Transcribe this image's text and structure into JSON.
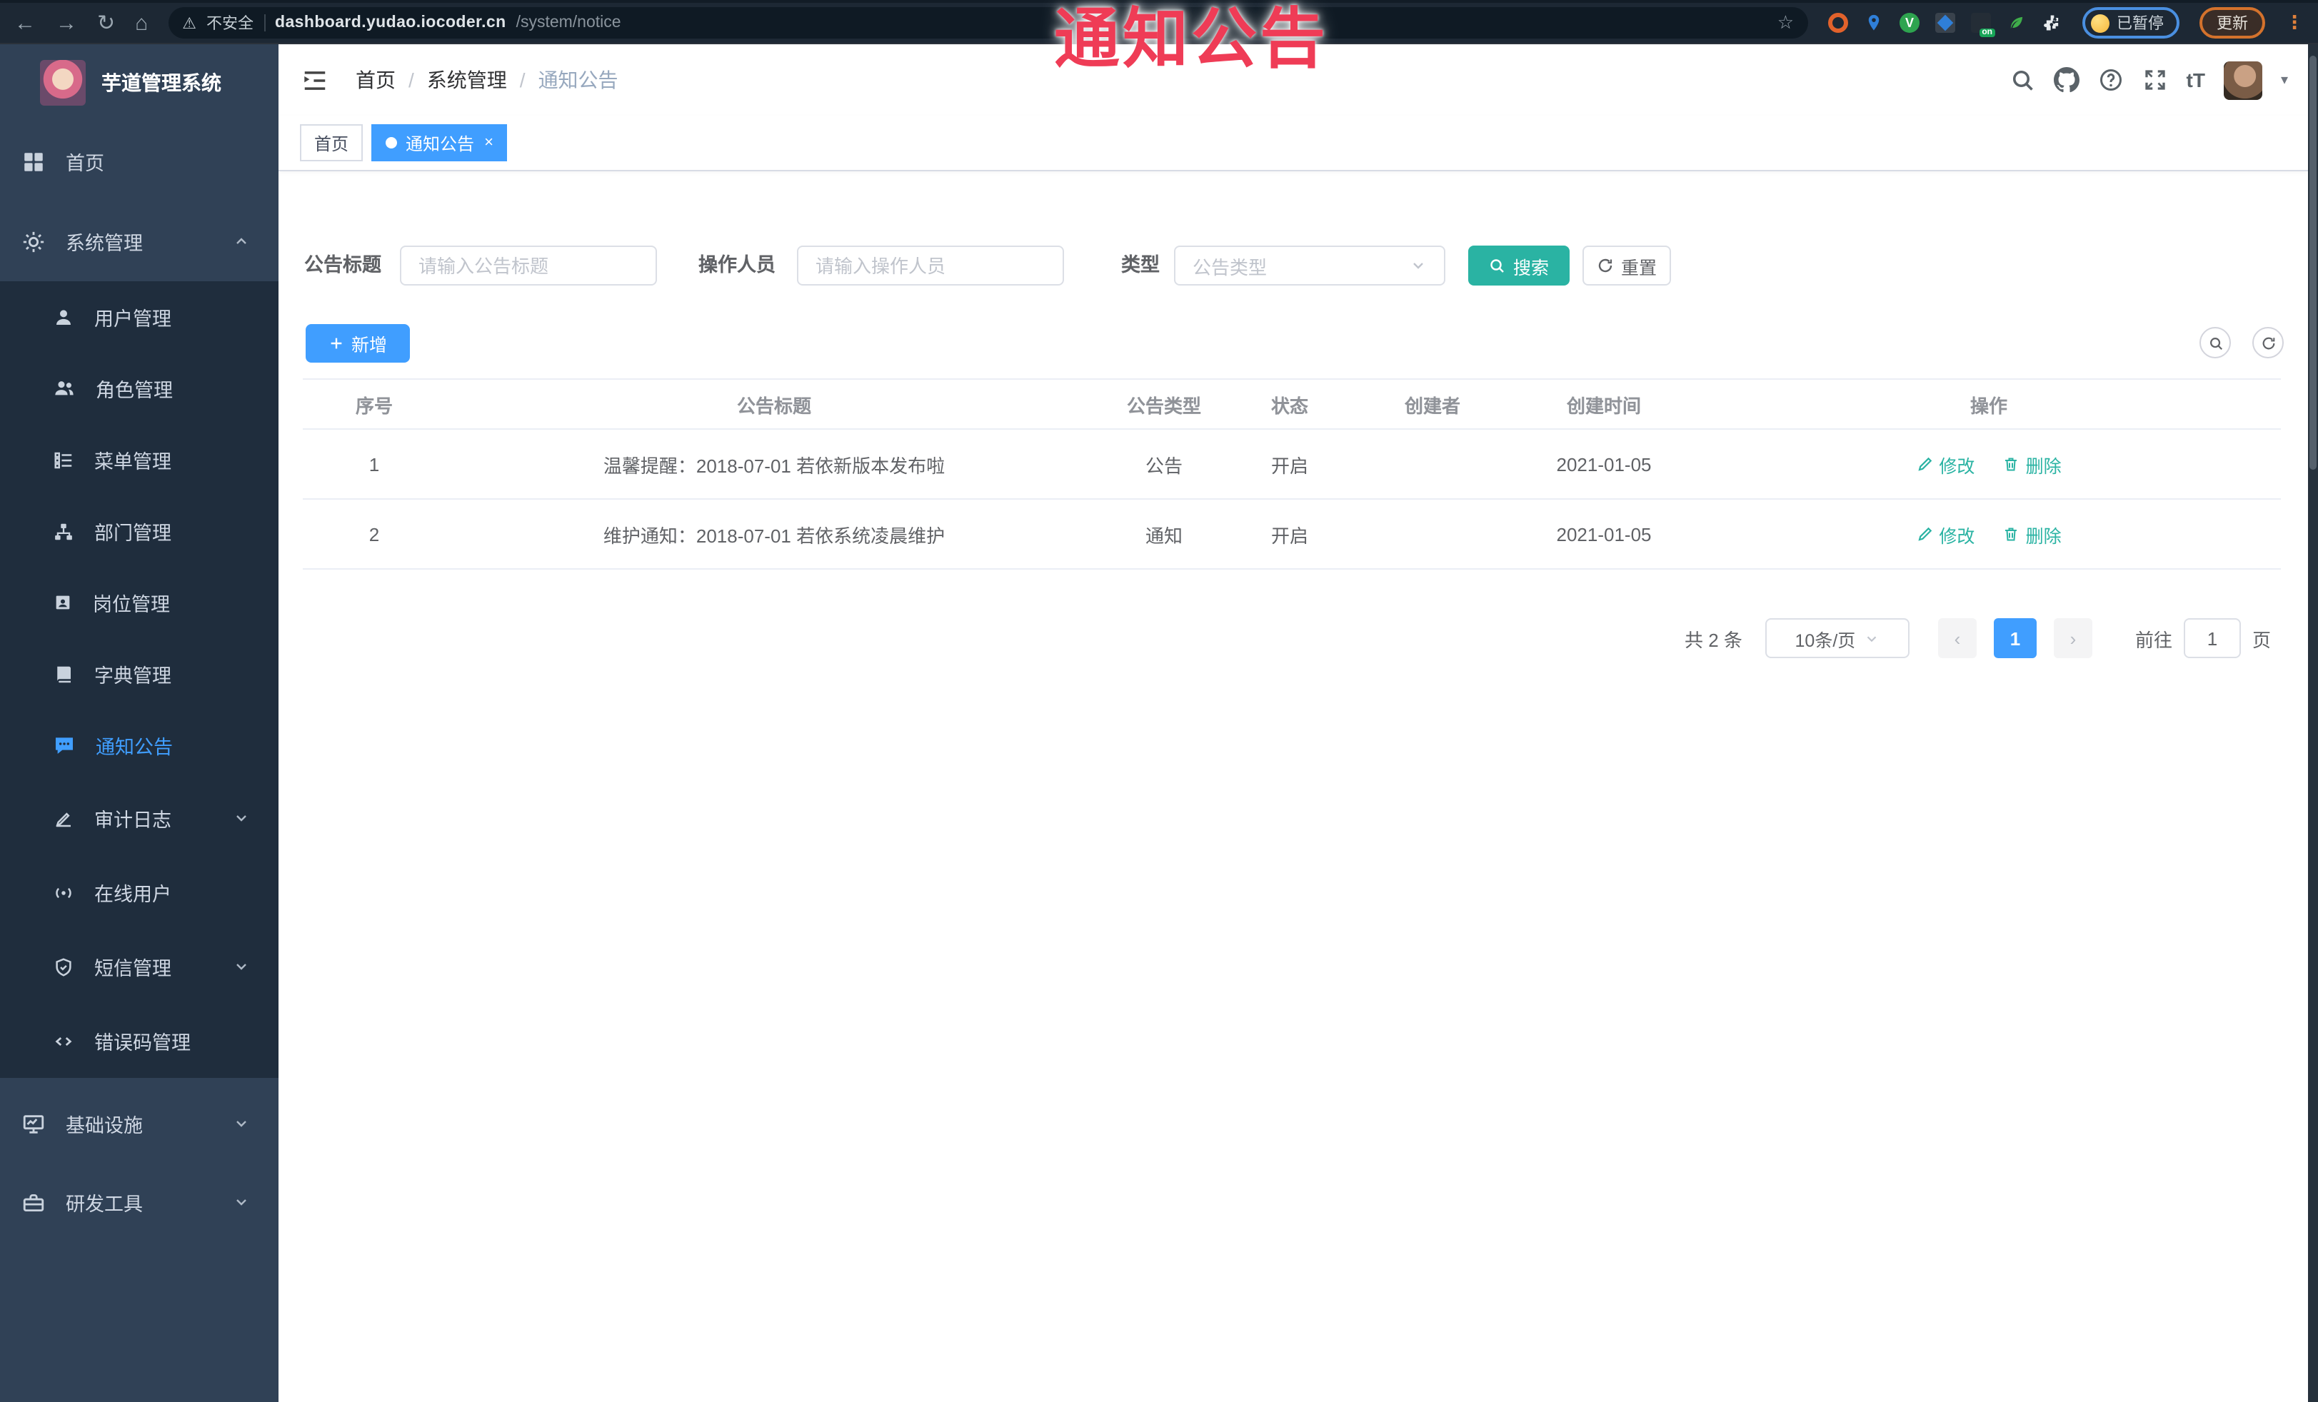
{
  "browser": {
    "security_label": "不安全",
    "url_host": "dashboard.yudao.iocoder.cn",
    "url_path": "/system/notice",
    "extension_badge": "on",
    "paused_label": "已暂停",
    "update_label": "更新"
  },
  "watermark": {
    "text": "通知公告",
    "color": "#ef3c56"
  },
  "sidebar": {
    "title": "芋道管理系统",
    "items": [
      {
        "label": "首页",
        "icon": "dashboard-icon"
      },
      {
        "label": "系统管理",
        "icon": "gear-icon",
        "arrow": "up",
        "expanded": true
      },
      {
        "label": "用户管理",
        "icon": "user-icon"
      },
      {
        "label": "角色管理",
        "icon": "users-icon"
      },
      {
        "label": "菜单管理",
        "icon": "menu-tree-icon"
      },
      {
        "label": "部门管理",
        "icon": "org-icon"
      },
      {
        "label": "岗位管理",
        "icon": "post-badge-icon"
      },
      {
        "label": "字典管理",
        "icon": "dictionary-icon"
      },
      {
        "label": "通知公告",
        "icon": "notice-bubble-icon",
        "active": true
      },
      {
        "label": "审计日志",
        "icon": "audit-pen-icon",
        "arrow": "down"
      },
      {
        "label": "在线用户",
        "icon": "online-user-icon"
      },
      {
        "label": "短信管理",
        "icon": "sms-shield-icon",
        "arrow": "down"
      },
      {
        "label": "错误码管理",
        "icon": "error-code-icon"
      },
      {
        "label": "基础设施",
        "icon": "infrastructure-icon",
        "arrow": "down"
      },
      {
        "label": "研发工具",
        "icon": "dev-tools-icon",
        "arrow": "down"
      }
    ]
  },
  "header": {
    "breadcrumb": [
      "首页",
      "系统管理",
      "通知公告"
    ],
    "font_size_icon_text": "tT"
  },
  "tabs": [
    {
      "label": "首页",
      "active": false
    },
    {
      "label": "通知公告",
      "active": true,
      "close": "×"
    }
  ],
  "filters": {
    "title_label": "公告标题",
    "title_placeholder": "请输入公告标题",
    "operator_label": "操作人员",
    "operator_placeholder": "请输入操作人员",
    "type_label": "类型",
    "type_placeholder": "公告类型",
    "search_label": "搜索",
    "reset_label": "重置"
  },
  "toolbar": {
    "add_label": "新增"
  },
  "table": {
    "columns": [
      "序号",
      "公告标题",
      "公告类型",
      "状态",
      "创建者",
      "创建时间",
      "操作"
    ],
    "rows": [
      {
        "no": "1",
        "title": "温馨提醒：2018-07-01 若依新版本发布啦",
        "type": "公告",
        "status": "开启",
        "creator": "",
        "created": "2021-01-05"
      },
      {
        "no": "2",
        "title": "维护通知：2018-07-01 若依系统凌晨维护",
        "type": "通知",
        "status": "开启",
        "creator": "",
        "created": "2021-01-05"
      }
    ],
    "edit_label": "修改",
    "delete_label": "删除"
  },
  "pagination": {
    "total_label": "共 2 条",
    "page_size_label": "10条/页",
    "prev_label": "‹",
    "current_page": "1",
    "next_label": "›",
    "goto_label": "前往",
    "goto_value": "1",
    "unit_label": "页"
  },
  "colors": {
    "primary": "#409eff",
    "search_teal": "#2ab3a3",
    "sidebar_bg": "#304156",
    "submenu_bg": "#1f2d3d",
    "chrome_bg": "#1d2834",
    "watermark_red": "#ef3c56"
  }
}
